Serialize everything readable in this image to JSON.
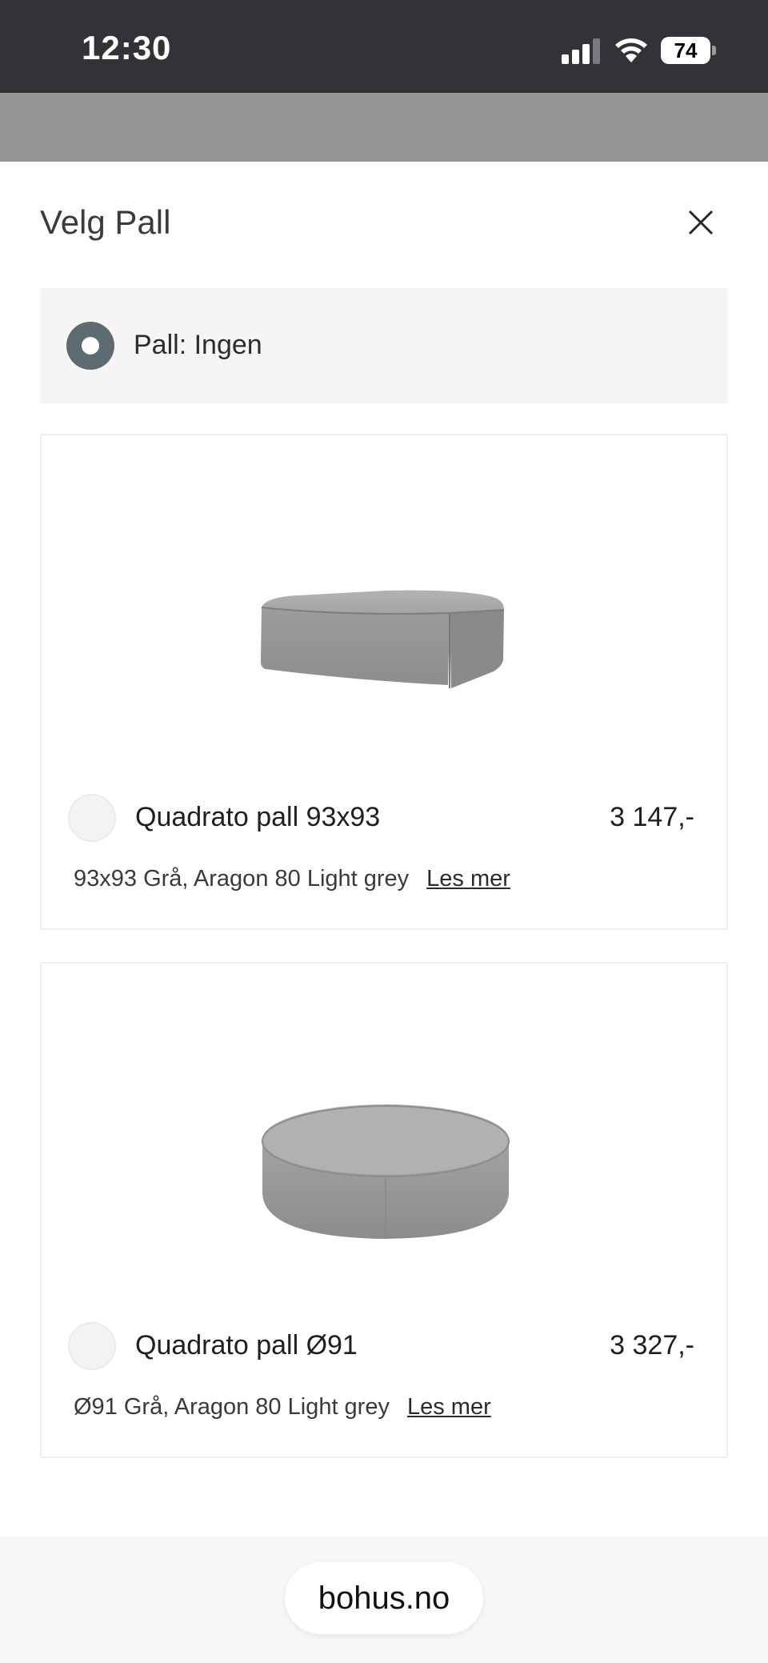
{
  "status_bar": {
    "time": "12:30",
    "battery": "74",
    "icons": [
      "cellular-signal-icon",
      "wifi-icon",
      "battery-icon"
    ]
  },
  "sheet": {
    "title": "Velg Pall",
    "close_icon": "close-icon",
    "none_option": {
      "label": "Pall: Ingen",
      "selected": true
    },
    "products": [
      {
        "name": "Quadrato pall 93x93",
        "price": "3 147,-",
        "description": "93x93 Grå, Aragon 80 Light grey",
        "link": "Les mer",
        "selected": false,
        "image": "square-ottoman-image"
      },
      {
        "name": "Quadrato pall Ø91",
        "price": "3 327,-",
        "description": "Ø91 Grå, Aragon 80 Light grey",
        "link": "Les mer",
        "selected": false,
        "image": "round-ottoman-image"
      }
    ]
  },
  "browser": {
    "url": "bohus.no"
  },
  "colors": {
    "status_bar": "#333337",
    "backdrop": "#969696",
    "radio_selected": "#5e6b70",
    "option_background": "#f6f4f4"
  }
}
